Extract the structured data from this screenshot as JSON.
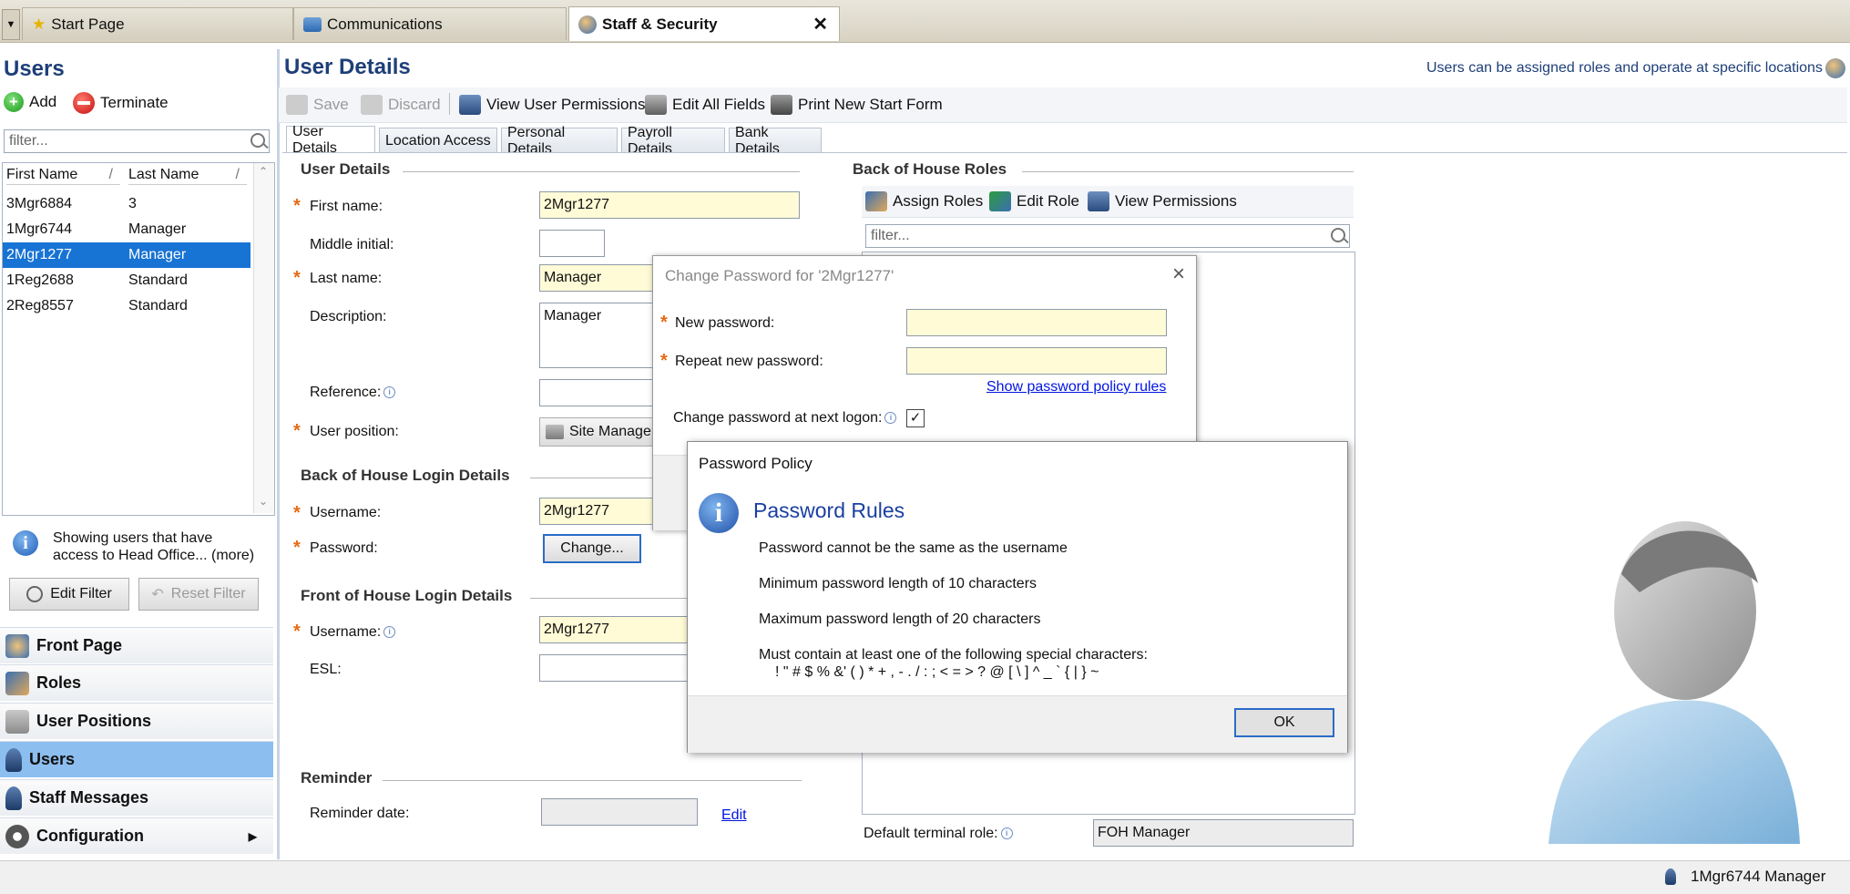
{
  "tabs": [
    {
      "label": "Start Page"
    },
    {
      "label": "Communications"
    },
    {
      "label": "Staff & Security",
      "close": "✕"
    }
  ],
  "left": {
    "title": "Users",
    "add": "Add",
    "terminate": "Terminate",
    "filter_placeholder": "filter...",
    "grid": {
      "headers": [
        "First Name",
        "Last Name"
      ],
      "rows": [
        {
          "first": "3Mgr6884",
          "last": "3"
        },
        {
          "first": "1Mgr6744",
          "last": "Manager"
        },
        {
          "first": "2Mgr1277",
          "last": "Manager"
        },
        {
          "first": "1Reg2688",
          "last": "Standard"
        },
        {
          "first": "2Reg8557",
          "last": "Standard"
        }
      ]
    },
    "showing_line1": "Showing users that have",
    "showing_line2": "access to Head Office... (more)",
    "edit_filter": "Edit Filter",
    "reset_filter": "Reset Filter",
    "nav": [
      {
        "label": "Front Page"
      },
      {
        "label": "Roles"
      },
      {
        "label": "User Positions"
      },
      {
        "label": "Users"
      },
      {
        "label": "Staff Messages"
      },
      {
        "label": "Configuration"
      }
    ]
  },
  "main": {
    "title": "User Details",
    "hint": "Users can be assigned roles and operate at specific locations",
    "toolbar": {
      "save": "Save",
      "discard": "Discard",
      "view_perms": "View User Permissions",
      "edit_all": "Edit All Fields",
      "print": "Print New Start Form"
    },
    "tabs": [
      "User Details",
      "Location Access",
      "Personal Details",
      "Payroll Details",
      "Bank Details"
    ],
    "user_details": {
      "heading": "User Details",
      "first_name_label": "First name:",
      "first_name": "2Mgr1277",
      "middle_label": "Middle initial:",
      "middle": "",
      "last_name_label": "Last name:",
      "last_name": "Manager",
      "description_label": "Description:",
      "description": "Manager",
      "reference_label": "Reference:",
      "position_label": "User position:",
      "position": "Site Manager"
    },
    "boh_login": {
      "heading": "Back of House Login Details",
      "username_label": "Username:",
      "username": "2Mgr1277",
      "password_label": "Password:",
      "change": "Change..."
    },
    "foh_login": {
      "heading": "Front of House Login Details",
      "username_label": "Username:",
      "username": "2Mgr1277",
      "esl_label": "ESL:"
    },
    "reminder": {
      "heading": "Reminder",
      "date_label": "Reminder date:",
      "edit": "Edit"
    },
    "boh_roles": {
      "heading": "Back of House Roles",
      "assign": "Assign Roles",
      "edit_role": "Edit Role",
      "view_perms": "View Permissions",
      "filter_placeholder": "filter...",
      "default_role_label": "Default terminal role:",
      "default_role": "FOH Manager"
    }
  },
  "change_password": {
    "title": "Change Password for '2Mgr1277'",
    "new_label": "New password:",
    "repeat_label": "Repeat new password:",
    "policy_link": "Show password policy rules",
    "change_next_label": "Change password at next logon:",
    "change_next_checked": true
  },
  "policy": {
    "title": "Password Policy",
    "heading": "Password Rules",
    "rules": [
      "Password cannot be the same as the username",
      "Minimum password length of 10 characters",
      "Maximum password length of 20 characters",
      "Must contain at  least one of the following special characters:"
    ],
    "special_chars": "! \" # $ % &' ( ) * + , - . / : ; < = > ? @ [ \\ ] ^ _ ` { | } ~",
    "ok": "OK"
  },
  "status": {
    "user": "1Mgr6744 Manager"
  },
  "colors": {
    "accent": "#1773d4",
    "title_blue": "#1e3f78",
    "required": "#e56b16",
    "required_field": "#fffbd6"
  }
}
